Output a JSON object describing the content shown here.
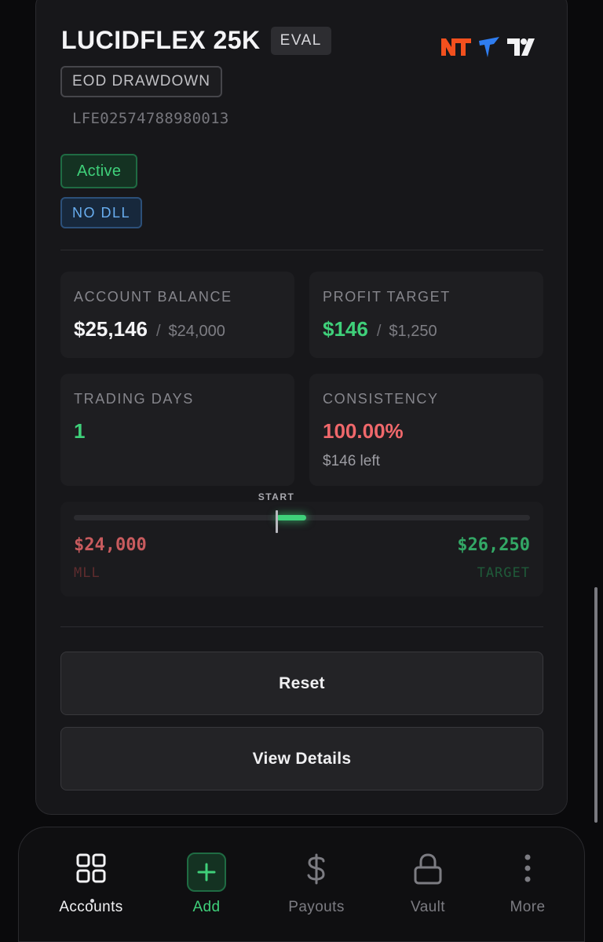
{
  "account": {
    "title": "LUCIDFLEX 25K",
    "type_badge": "EVAL",
    "drawdown_type": "EOD DRAWDOWN",
    "account_id": "LFE02574788980013",
    "status": "Active",
    "dll_badge": "NO DLL",
    "platforms": [
      "ninjatrader-logo",
      "tradovate-logo",
      "tradingview-logo"
    ]
  },
  "stats": {
    "balance": {
      "label": "ACCOUNT BALANCE",
      "value": "$25,146",
      "sub": "$24,000"
    },
    "profit_target": {
      "label": "PROFIT TARGET",
      "value": "$146",
      "sub": "$1,250"
    },
    "trading_days": {
      "label": "TRADING DAYS",
      "value": "1"
    },
    "consistency": {
      "label": "CONSISTENCY",
      "value": "100.00%",
      "note": "$146 left"
    }
  },
  "progress": {
    "start_label": "START",
    "min": 24000,
    "start": 25000,
    "current": 25146,
    "target": 26250,
    "mll_value": "$24,000",
    "mll_label": "MLL",
    "target_value": "$26,250",
    "target_label": "TARGET"
  },
  "buttons": {
    "reset": "Reset",
    "view_details": "View Details"
  },
  "nav": {
    "items": [
      {
        "label": "Accounts",
        "icon": "grid-icon",
        "active": true
      },
      {
        "label": "Add",
        "icon": "plus-icon"
      },
      {
        "label": "Payouts",
        "icon": "dollar-icon"
      },
      {
        "label": "Vault",
        "icon": "lock-icon"
      },
      {
        "label": "More",
        "icon": "more-vertical-icon"
      }
    ]
  },
  "colors": {
    "accent_green": "#3fd07a",
    "loss_red": "#f0686b",
    "info_blue": "#69aef0",
    "background": "#0a0a0c",
    "card": "#17171a"
  }
}
